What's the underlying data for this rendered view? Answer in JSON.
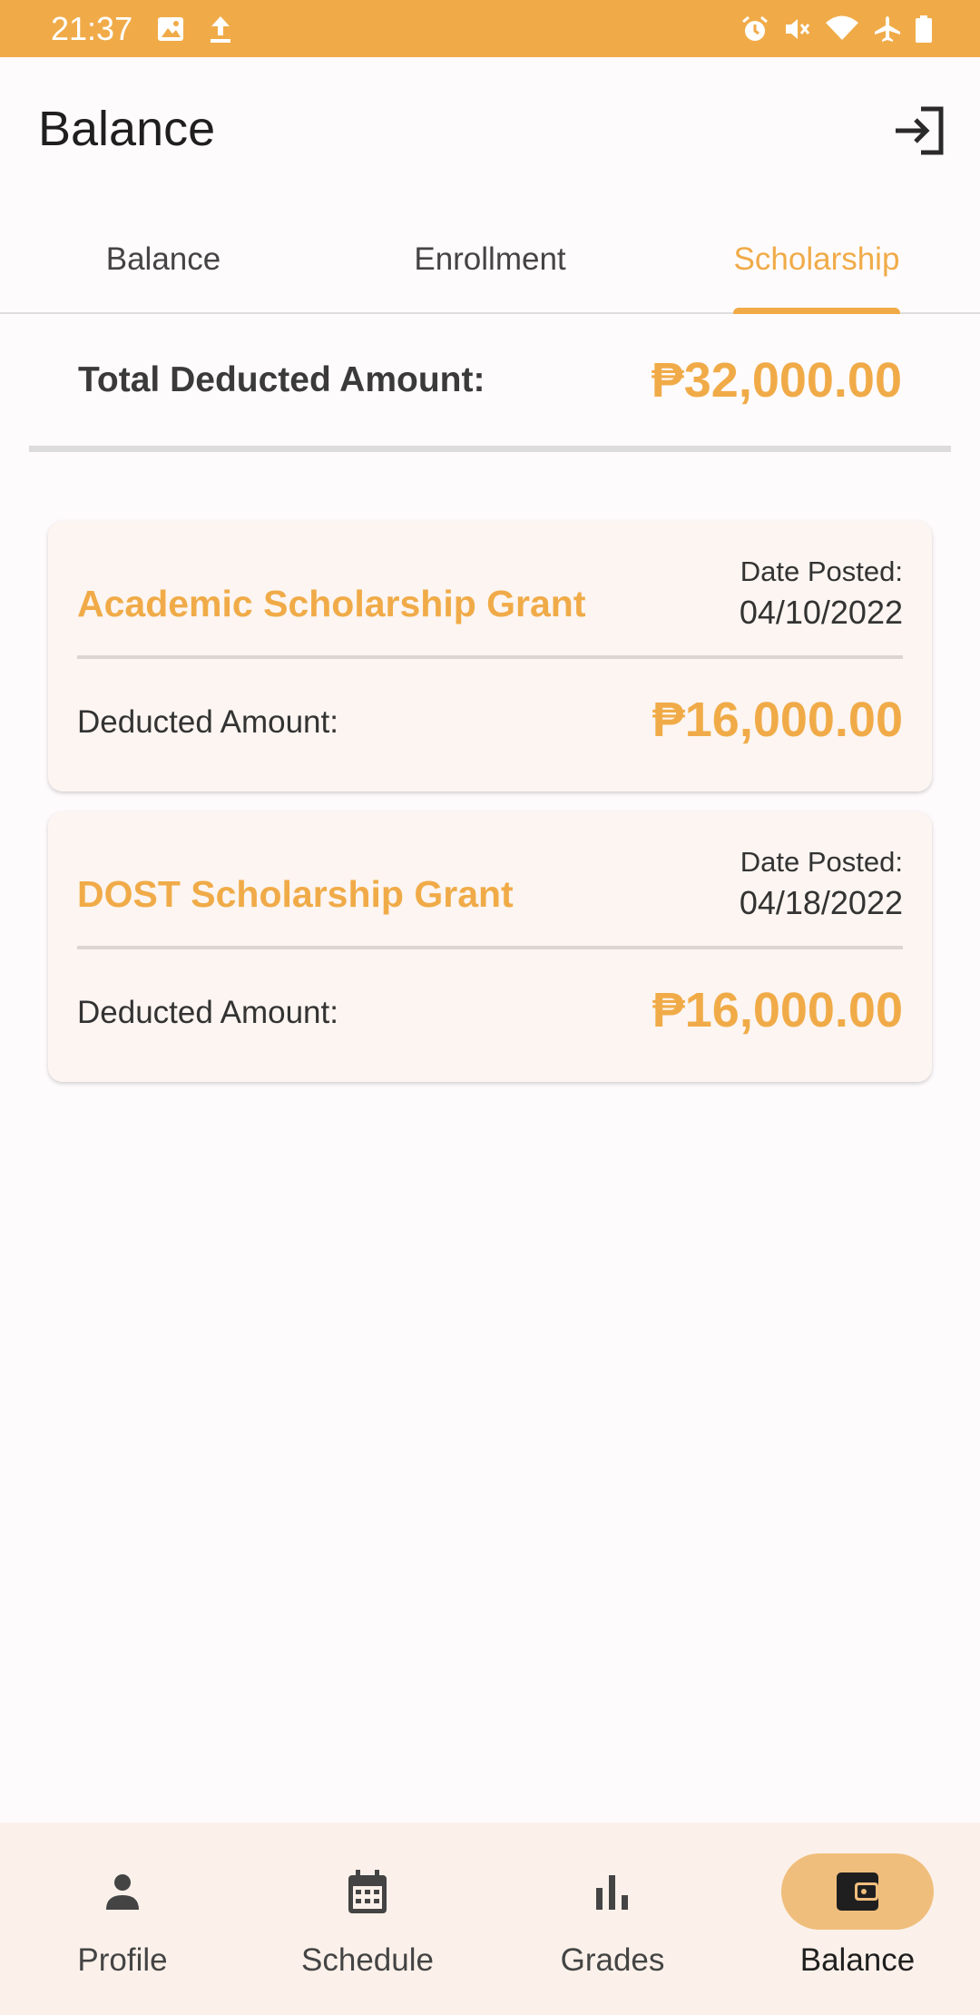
{
  "status_bar": {
    "time": "21:37",
    "left_icons": [
      "image-icon",
      "upload-icon"
    ],
    "right_icons": [
      "alarm-icon",
      "vibrate-mute-icon",
      "wifi-icon",
      "airplane-icon",
      "battery-icon"
    ]
  },
  "app_bar": {
    "title": "Balance",
    "action_icon": "logout-icon"
  },
  "tabs": [
    {
      "label": "Balance",
      "active": false
    },
    {
      "label": "Enrollment",
      "active": false
    },
    {
      "label": "Scholarship",
      "active": true
    }
  ],
  "summary": {
    "label": "Total Deducted Amount:",
    "value": "₱32,000.00"
  },
  "scholarships": [
    {
      "title": "Academic Scholarship Grant",
      "date_label": "Date Posted:",
      "date": "04/10/2022",
      "amount_label": "Deducted Amount:",
      "amount": "₱16,000.00"
    },
    {
      "title": "DOST Scholarship Grant",
      "date_label": "Date Posted:",
      "date": "04/18/2022",
      "amount_label": "Deducted Amount:",
      "amount": "₱16,000.00"
    }
  ],
  "bottom_nav": [
    {
      "label": "Profile",
      "icon": "person-icon",
      "active": false
    },
    {
      "label": "Schedule",
      "icon": "calendar-icon",
      "active": false
    },
    {
      "label": "Grades",
      "icon": "bar-chart-icon",
      "active": false
    },
    {
      "label": "Balance",
      "icon": "wallet-icon",
      "active": true
    }
  ],
  "colors": {
    "accent": "#f0ab48",
    "status_bar": "#f0ab48",
    "card_background": "#fcf5f1",
    "nav_background": "#fbf1ea",
    "active_nav_pill": "#f0be7c"
  }
}
